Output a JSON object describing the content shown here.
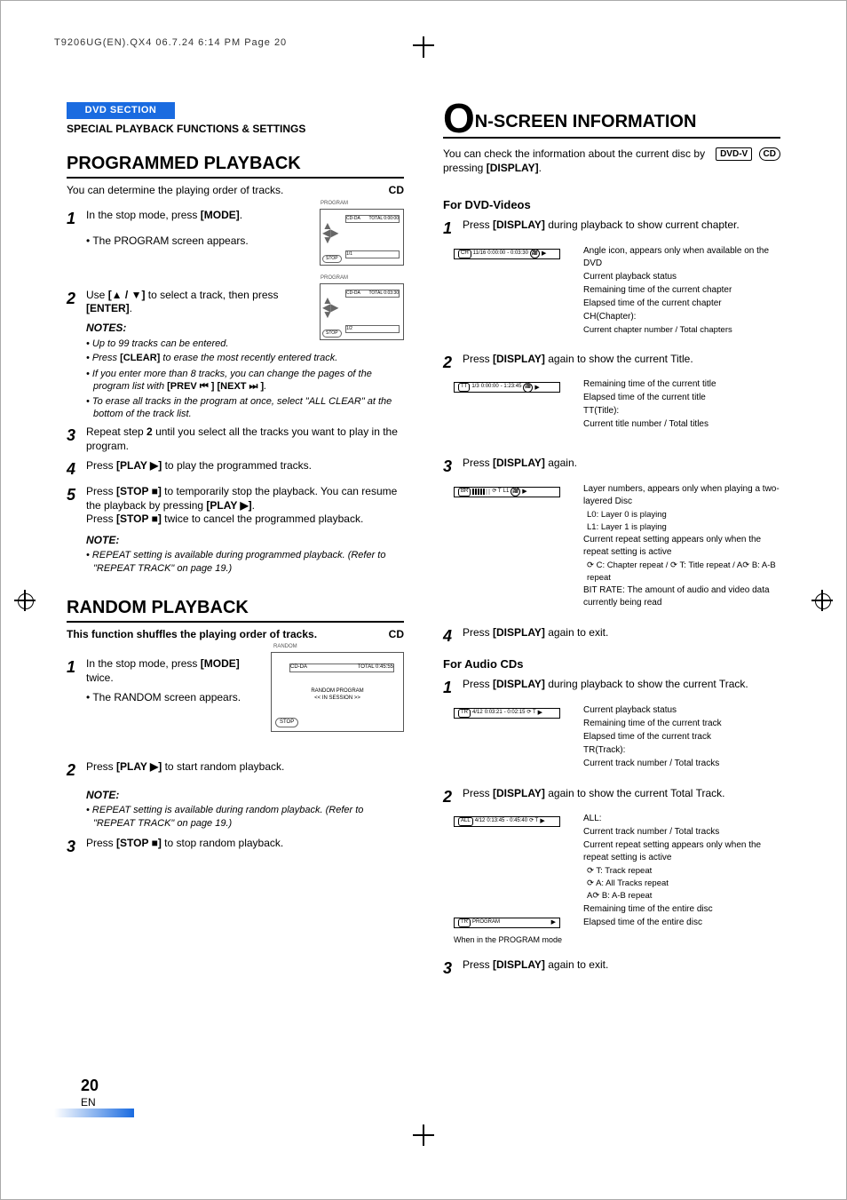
{
  "slug": "T9206UG(EN).QX4  06.7.24  6:14 PM  Page 20",
  "left": {
    "chip": "DVD SECTION",
    "subhead": "SPECIAL PLAYBACK FUNCTIONS & SETTINGS",
    "programmed": {
      "h": "PROGRAMMED PLAYBACK",
      "intro": "You can determine the playing order of tracks.",
      "badge": "CD",
      "s1_pre": "In the stop mode, press ",
      "s1_key": "[MODE]",
      "s1_post": ".",
      "b1": "The PROGRAM screen appears.",
      "osd1": {
        "tag": "PROGRAM",
        "cdda": "CD-DA",
        "total": "TOTAL 0:00:00",
        "pg": "1/1",
        "stop": "STOP"
      },
      "s2_pre": "Use ",
      "s2_key1": "[▲ / ▼]",
      "s2_mid": " to select a track, then press ",
      "s2_key2": "[ENTER]",
      "s2_post": ".",
      "osd2": {
        "tag": "PROGRAM",
        "cdda": "CD-DA",
        "total": "TOTAL 0:03:30",
        "pg": "1/2",
        "stop": "STOP"
      },
      "notes_h": "NOTES:",
      "n1": "Up to 99 tracks can be entered.",
      "n2_pre": "Press ",
      "n2_key": "[CLEAR]",
      "n2_post": " to erase the most recently entered track.",
      "n3_pre": "If you enter more than 8 tracks, you can change the pages of the program list with ",
      "n3_key1": "[PREV ⏮ ]",
      "n3_key2": "[NEXT ⏭ ]",
      "n3_mid": " ",
      "n3_post": ".",
      "n4_pre": "To erase all tracks in the program at once, select \"ALL CLEAR\" at the bottom of the track list.",
      "s3_pre": "Repeat step ",
      "s3_b": "2",
      "s3_post": " until you select all the tracks you want to play in the program.",
      "s4_pre": "Press ",
      "s4_key": "[PLAY ▶]",
      "s4_post": " to play the programmed tracks.",
      "s5_pre": "Press ",
      "s5_key1": "[STOP ■]",
      "s5_mid1": " to temporarily stop the playback. You can resume the playback by pressing ",
      "s5_key2": "[PLAY ▶]",
      "s5_mid2": ".",
      "s5_line2_pre": "Press ",
      "s5_line2_key": "[STOP ■]",
      "s5_line2_post": " twice to cancel the programmed playback.",
      "note2_h": "NOTE:",
      "note2": "REPEAT setting is available during programmed playback. (Refer to \"REPEAT TRACK\" on page 19.)"
    },
    "random": {
      "h": "RANDOM PLAYBACK",
      "intro": "This function shuffles the playing order of tracks.",
      "badge": "CD",
      "s1_pre": "In the stop mode, press ",
      "s1_key": "[MODE]",
      "s1_post": " twice.",
      "b1": "The RANDOM screen appears.",
      "osd": {
        "tag": "RANDOM",
        "cdda": "CD-DA",
        "total": "TOTAL 0:45:55",
        "msg1": "RANDOM PROGRAM",
        "msg2": "<< IN SESSION >>",
        "stop": "STOP"
      },
      "s2_pre": "Press ",
      "s2_key": "[PLAY ▶]",
      "s2_post": " to start random playback.",
      "note_h": "NOTE:",
      "note": "REPEAT setting is available during random playback. (Refer to \"REPEAT TRACK\" on page 19.)",
      "s3_pre": "Press ",
      "s3_key": "[STOP ■]",
      "s3_post": " to stop random playback."
    }
  },
  "right": {
    "O": "O",
    "h": "N-SCREEN INFORMATION",
    "intro_pre": "You can check the information about the current disc by pressing ",
    "intro_key": "[DISPLAY]",
    "intro_post": ".",
    "badge_dvd": "DVD-V",
    "badge_cd": "CD",
    "dvd_h": "For DVD-Videos",
    "d1_pre": "Press ",
    "d1_key": "[DISPLAY]",
    "d1_post": " during playback to show current chapter.",
    "d1_callouts": {
      "angle": "Angle icon, appears only when available on the DVD",
      "status": "Current playback status",
      "remain": "Remaining time of the current chapter",
      "elapsed": "Elapsed time of the current chapter",
      "ch": "CH(Chapter):",
      "ch_sub": "Current chapter number / Total chapters"
    },
    "d1_strip": [
      "CH",
      "11/16",
      "0:00:00",
      "- 0:03:30",
      "🎥",
      "▶"
    ],
    "d2_pre": "Press ",
    "d2_key": "[DISPLAY]",
    "d2_post": " again to show the current Title.",
    "d2_callouts": {
      "remain": "Remaining time of the current title",
      "elapsed": "Elapsed time of the current title",
      "tt": "TT(Title):",
      "tt_sub": "Current title number / Total titles"
    },
    "d2_strip": [
      "TT",
      "1/3",
      "0:00:00",
      "- 1:23:45",
      "🎥",
      "▶"
    ],
    "d3_pre": "Press ",
    "d3_key": "[DISPLAY]",
    "d3_post": " again.",
    "d3_callouts": {
      "layer": "Layer numbers, appears only when playing a two-layered Disc",
      "l0": "L0: Layer 0 is playing",
      "l1": "L1: Layer 1 is playing",
      "repeat": "Current repeat setting appears only when the repeat setting is active",
      "rc": "⟳ C: Chapter repeat / ⟳ T: Title repeat / A⟳ B: A-B repeat",
      "bitrate": "BIT RATE: The amount of audio and video data currently being read"
    },
    "d3_strip": [
      "BR",
      "▮▮▮▮▮▯▯",
      "⟳ T",
      "L1",
      "🎥",
      "▶"
    ],
    "d4_pre": "Press ",
    "d4_key": "[DISPLAY]",
    "d4_post": " again to exit.",
    "cd_h": "For Audio CDs",
    "c1_pre": "Press ",
    "c1_key": "[DISPLAY]",
    "c1_post": " during playback to show  the current Track.",
    "c1_callouts": {
      "status": "Current playback status",
      "remain": "Remaining time of the current track",
      "elapsed": "Elapsed time of the current track",
      "tr": "TR(Track):",
      "tr_sub": "Current track number / Total tracks"
    },
    "c1_strip": [
      "TR",
      "4/12",
      "0:03:21",
      "- 0:02:15",
      "⟳ T",
      "▶"
    ],
    "c2_pre": "Press ",
    "c2_key": "[DISPLAY]",
    "c2_post": " again to show the current Total Track.",
    "c2_callouts": {
      "all": "ALL:",
      "all_sub": "Current track number / Total tracks",
      "repeat": "Current repeat setting appears only when the repeat setting is active",
      "rt": "⟳ T: Track repeat",
      "ra": "⟳ A: All Tracks repeat",
      "rab": "A⟳ B: A-B repeat",
      "remain": "Remaining time of the entire disc",
      "elapsed": "Elapsed time of the entire disc"
    },
    "c2_strip": [
      "ALL",
      "4/12",
      "0:13:45",
      "- 0:45:40",
      "⟳ T",
      "▶"
    ],
    "c2_prog_strip": [
      "TR",
      "PROGRAM",
      "",
      "",
      "",
      "▶"
    ],
    "c2_prog_note": "When in the PROGRAM mode",
    "c3_pre": "Press ",
    "c3_key": "[DISPLAY]",
    "c3_post": " again to exit."
  },
  "footer": {
    "page": "20",
    "lang": "EN"
  }
}
